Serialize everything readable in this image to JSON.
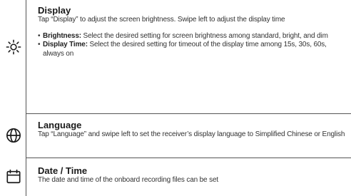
{
  "rows": [
    {
      "title": "Display",
      "icon": "brightness-icon",
      "description": "Tap “Display” to adjust the screen brightness. Swipe left to adjust the display time",
      "bullets": [
        {
          "label": "Brightness:",
          "text": " Select the desired setting for screen brightness among standard, bright, and dim"
        },
        {
          "label": "Display Time:",
          "text": " Select the desired setting for timeout of the display time among 15s, 30s, 60s, always on"
        }
      ]
    },
    {
      "title": "Language",
      "icon": "globe-icon",
      "description": "Tap “Language” and swipe left to set the receiver’s display language to Simplified Chinese or English"
    },
    {
      "title": "Date / Time",
      "icon": "calendar-icon",
      "description": "The date and time of the onboard recording files can be set"
    }
  ],
  "bullet_glyph": "•"
}
